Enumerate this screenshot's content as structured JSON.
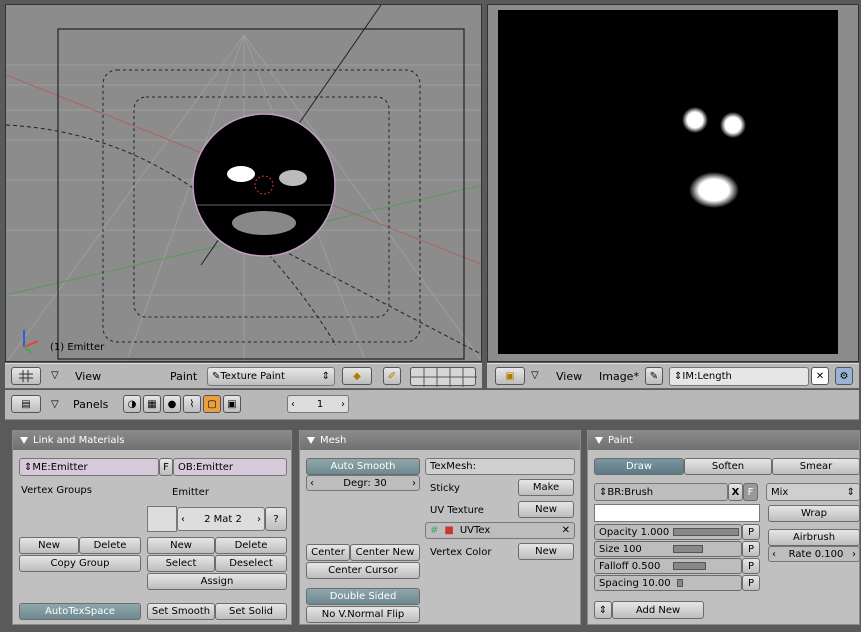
{
  "viewport3d": {
    "object_label": "(1) Emitter"
  },
  "header3d": {
    "view_label": "View",
    "mode_label": "Paint",
    "mode_value": "Texture Paint"
  },
  "headerimg": {
    "view_label": "View",
    "image_label": "Image*",
    "image_name": "IM:Length"
  },
  "buttons_header": {
    "panels_label": "Panels",
    "page_value": "1"
  },
  "link_materials": {
    "title": "Link and Materials",
    "mesh_field": "ME:Emitter",
    "f_label": "F",
    "object_field": "OB:Emitter",
    "vertex_groups_label": "Vertex Groups",
    "emitter_label": "Emitter",
    "mat_value": "2 Mat 2",
    "question": "?",
    "vg_new": "New",
    "vg_delete": "Delete",
    "copy_group": "Copy Group",
    "mat_new": "New",
    "mat_delete": "Delete",
    "select": "Select",
    "deselect": "Deselect",
    "assign": "Assign",
    "autotexspace": "AutoTexSpace",
    "set_smooth": "Set Smooth",
    "set_solid": "Set Solid"
  },
  "mesh": {
    "title": "Mesh",
    "auto_smooth": "Auto Smooth",
    "degr": "Degr: 30",
    "texmesh": "TexMesh:",
    "sticky": "Sticky",
    "make": "Make",
    "uv_texture": "UV Texture",
    "uv_new": "New",
    "uvtex": "UVTex",
    "vertex_color": "Vertex Color",
    "vc_new": "New",
    "center": "Center",
    "center_new": "Center New",
    "center_cursor": "Center Cursor",
    "double_sided": "Double Sided",
    "no_vnormal_flip": "No V.Normal Flip"
  },
  "paint": {
    "title": "Paint",
    "draw": "Draw",
    "soften": "Soften",
    "smear": "Smear",
    "brush": "BR:Brush",
    "x_label": "X",
    "f_label": "F",
    "blend": "Mix",
    "opacity": "Opacity 1.000",
    "size": "Size 100",
    "falloff": "Falloff 0.500",
    "spacing": "Spacing 10.00",
    "p_label": "P",
    "wrap": "Wrap",
    "airbrush": "Airbrush",
    "rate": "Rate 0.100",
    "add_new": "Add New"
  },
  "colors": {
    "accent": "#7a96a0",
    "selected_face": "#000000",
    "outline": "#c49cc4"
  }
}
